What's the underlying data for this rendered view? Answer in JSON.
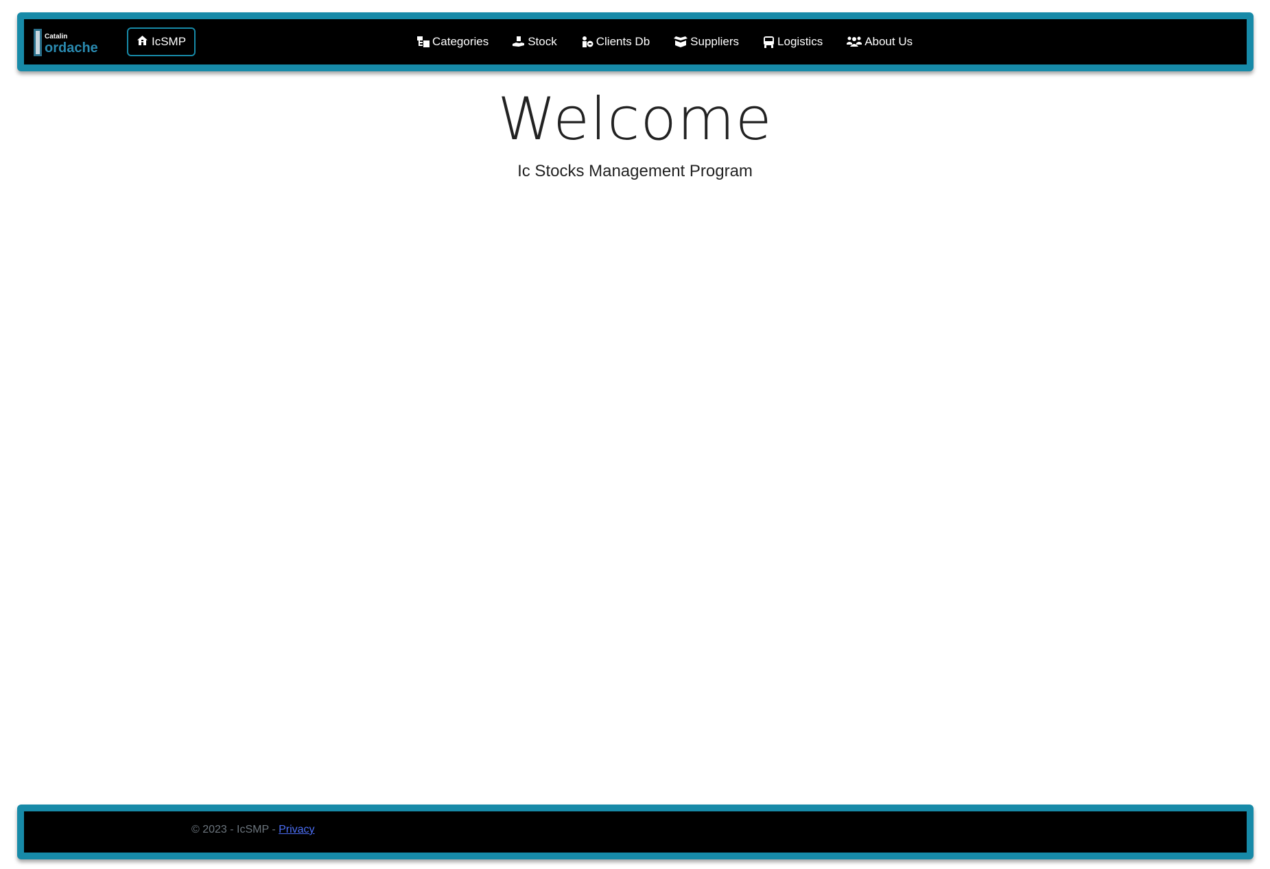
{
  "navbar": {
    "logo": {
      "line1": "Catalin",
      "line2": "ordache"
    },
    "brand_label": "IcSMP",
    "links": [
      {
        "label": "Categories",
        "icon": "sitemap-icon"
      },
      {
        "label": "Stock",
        "icon": "hand-holding-box-icon"
      },
      {
        "label": "Clients Db",
        "icon": "user-tag-icon"
      },
      {
        "label": "Suppliers",
        "icon": "box-open-icon"
      },
      {
        "label": "Logistics",
        "icon": "truck-icon"
      },
      {
        "label": "About Us",
        "icon": "users-icon"
      }
    ],
    "colors": {
      "bar_background": "#000000",
      "accent_border": "#178aa8"
    }
  },
  "hero": {
    "title": "Welcome",
    "subtitle": "Ic Stocks Management Program"
  },
  "footer": {
    "copyright": "© 2023 - IcSMP - ",
    "privacy_link": "Privacy",
    "colors": {
      "text": "#6c757d",
      "link": "#4b6ef5"
    }
  }
}
